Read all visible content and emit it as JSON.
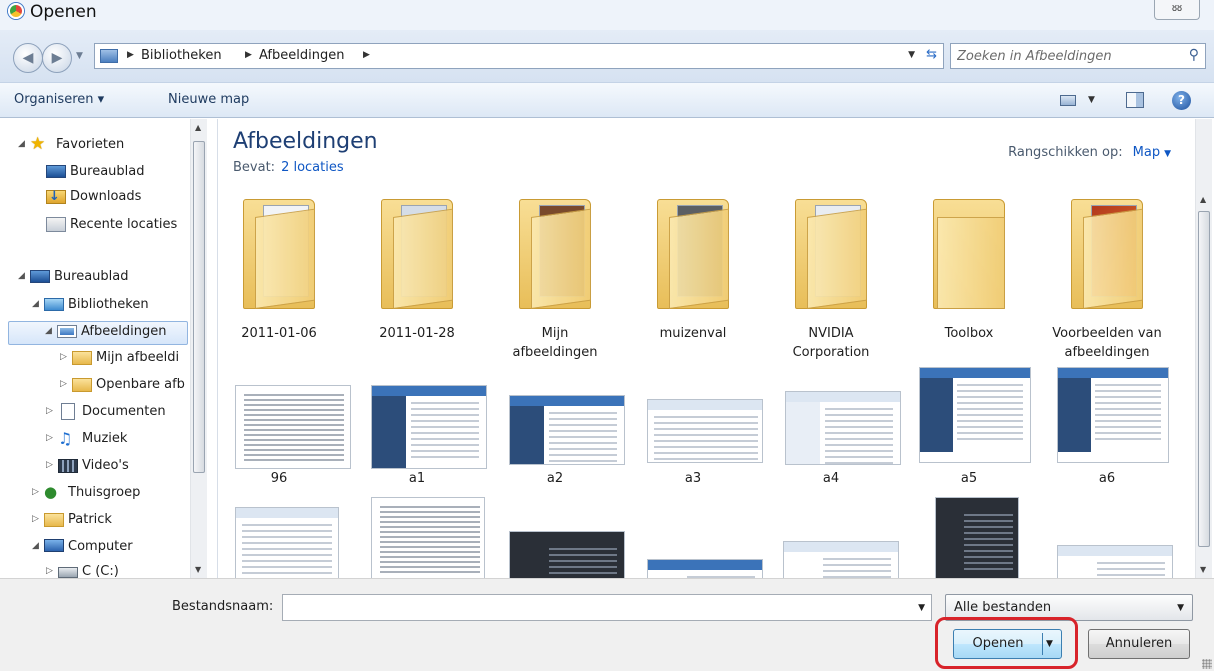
{
  "window": {
    "title": "Openen",
    "close_label": "ᴕᴕ"
  },
  "address": {
    "crumbs": [
      "Bibliotheken",
      "Afbeeldingen"
    ],
    "search_placeholder": "Zoeken in Afbeeldingen"
  },
  "toolbar": {
    "organize_label": "Organiseren ▾",
    "new_folder_label": "Nieuwe map"
  },
  "nav": {
    "items": [
      {
        "label": "Favorieten"
      },
      {
        "label": "Bureaublad"
      },
      {
        "label": "Downloads"
      },
      {
        "label": "Recente locaties"
      },
      {
        "label": "Bureaublad"
      },
      {
        "label": "Bibliotheken"
      },
      {
        "label": "Afbeeldingen"
      },
      {
        "label": "Mijn afbeeldi"
      },
      {
        "label": "Openbare afb"
      },
      {
        "label": "Documenten"
      },
      {
        "label": "Muziek"
      },
      {
        "label": "Video's"
      },
      {
        "label": "Thuisgroep"
      },
      {
        "label": "Patrick"
      },
      {
        "label": "Computer"
      },
      {
        "label": "C (C:)"
      }
    ]
  },
  "content": {
    "library_title": "Afbeeldingen",
    "contains_label": "Bevat:",
    "locations_link": "2 locaties",
    "arrange_label": "Rangschikken op:",
    "arrange_value": "Map",
    "folders": [
      {
        "line1": "2011-01-06",
        "line2": ""
      },
      {
        "line1": "2011-01-28",
        "line2": ""
      },
      {
        "line1": "Mijn",
        "line2": "afbeeldingen"
      },
      {
        "line1": "muizenval",
        "line2": ""
      },
      {
        "line1": "NVIDIA",
        "line2": "Corporation"
      },
      {
        "line1": "Toolbox",
        "line2": ""
      },
      {
        "line1": "Voorbeelden van",
        "line2": "afbeeldingen"
      }
    ],
    "files": [
      "96",
      "a1",
      "a2",
      "a3",
      "a4",
      "a5",
      "a6"
    ]
  },
  "footer": {
    "filename_label": "Bestandsnaam:",
    "filename_value": "",
    "filter_value": "Alle bestanden",
    "open_label": "Openen",
    "cancel_label": "Annuleren"
  },
  "colors": {
    "accent": "#1e3f74",
    "link": "#0f57c4",
    "highlight": "#d8232a"
  }
}
